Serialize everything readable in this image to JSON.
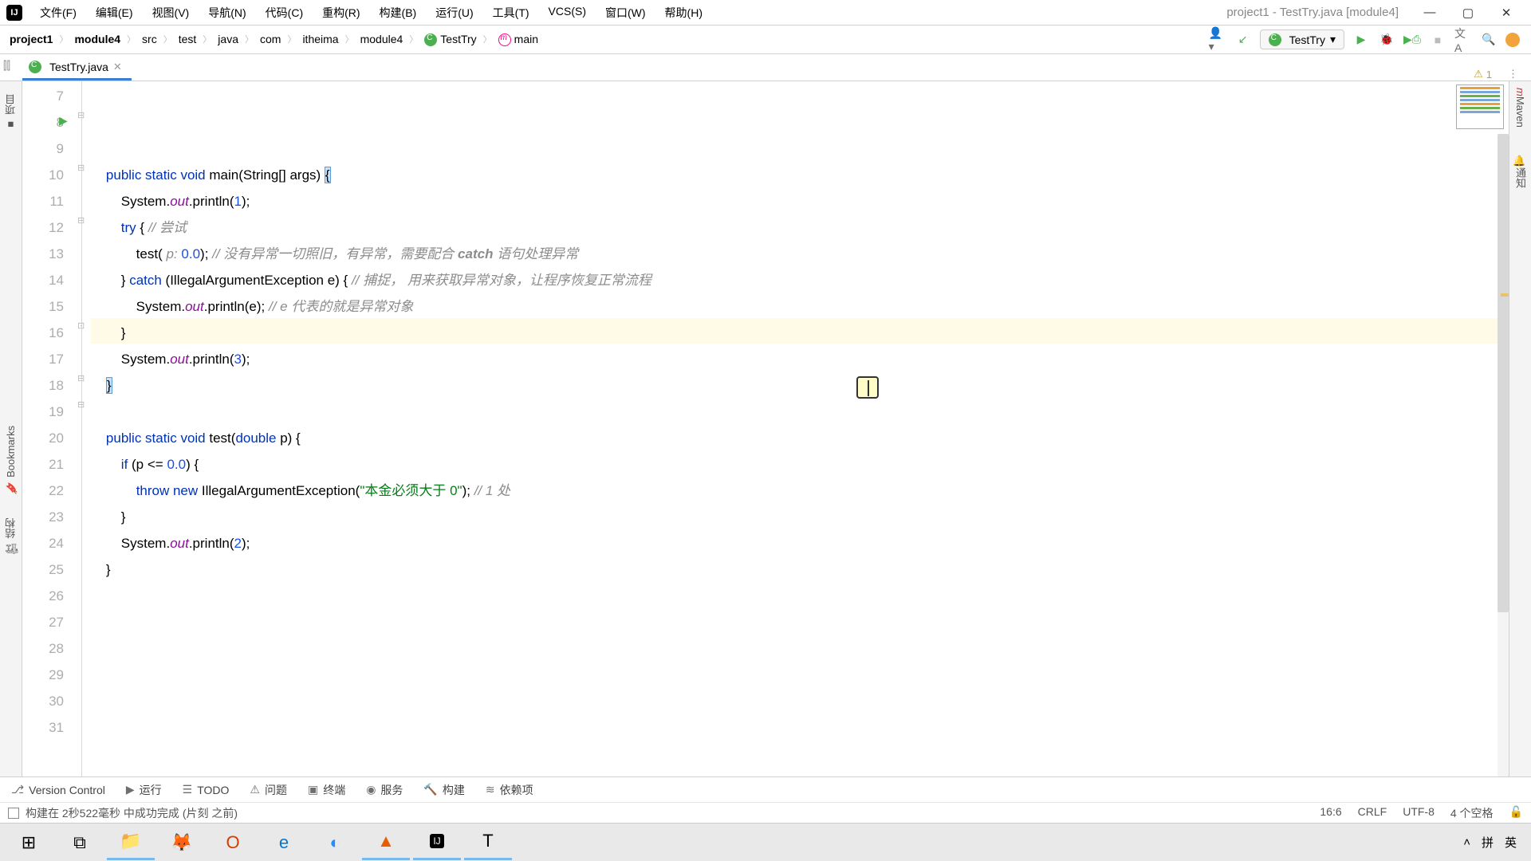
{
  "window": {
    "title": "project1 - TestTry.java [module4]"
  },
  "menu": {
    "items": [
      "文件(F)",
      "编辑(E)",
      "视图(V)",
      "导航(N)",
      "代码(C)",
      "重构(R)",
      "构建(B)",
      "运行(U)",
      "工具(T)",
      "VCS(S)",
      "窗口(W)",
      "帮助(H)"
    ]
  },
  "breadcrumb": {
    "items": [
      "project1",
      "module4",
      "src",
      "test",
      "java",
      "com",
      "itheima",
      "module4",
      "TestTry",
      "main"
    ]
  },
  "run_config": {
    "label": "TestTry"
  },
  "tabs": {
    "open": [
      {
        "label": "TestTry.java"
      }
    ]
  },
  "inspection": {
    "warnings": "1"
  },
  "left_rail": {
    "project": "项目",
    "bookmarks": "Bookmarks",
    "structure": "结构"
  },
  "right_rail": {
    "maven": "Maven",
    "notify": "通知"
  },
  "gutter": {
    "start": 7,
    "end": 31,
    "run_line": 8,
    "highlight_line": 16
  },
  "code_lines": [
    "",
    "    public static void main(String[] args) {",
    "        System.out.println(1);",
    "        try { // 尝试",
    "            test( p: 0.0); // 没有异常一切照旧，有异常，需要配合 catch 语句处理异常",
    "        } catch (IllegalArgumentException e) { // 捕捉，用来获取异常对象，让程序恢复正常流程",
    "            System.out.println(e); // e 代表的就是异常对象",
    "        }",
    "        System.out.println(3);",
    "    }",
    "",
    "    public static void test(double p) {",
    "        if (p <= 0.0) {",
    "            throw new IllegalArgumentException(\"本金必须大于 0\"); // 1 处",
    "        }",
    "        System.out.println(2);",
    "    }",
    "",
    "",
    "",
    "",
    "",
    "",
    "",
    ""
  ],
  "bottom_tools": {
    "items": [
      {
        "icon": "⎇",
        "label": "Version Control"
      },
      {
        "icon": "▶",
        "label": "运行"
      },
      {
        "icon": "☰",
        "label": "TODO"
      },
      {
        "icon": "⚠",
        "label": "问题"
      },
      {
        "icon": "▣",
        "label": "终端"
      },
      {
        "icon": "◉",
        "label": "服务"
      },
      {
        "icon": "🔨",
        "label": "构建"
      },
      {
        "icon": "≋",
        "label": "依赖项"
      }
    ]
  },
  "status": {
    "message": "构建在 2秒522毫秒 中成功完成 (片刻 之前)",
    "pos": "16:6",
    "eol": "CRLF",
    "enc": "UTF-8",
    "indent": "4 个空格"
  },
  "taskbar": {
    "ime": {
      "pinyin": "拼",
      "ch": "英"
    }
  }
}
